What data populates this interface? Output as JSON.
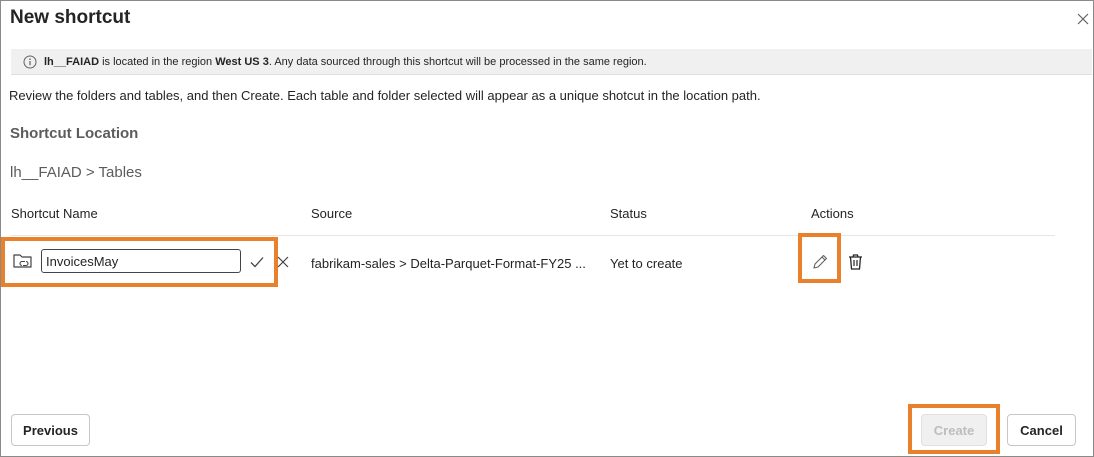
{
  "dialog": {
    "title": "New shortcut"
  },
  "banner": {
    "lakehouse": "lh__FAIAD",
    "text_1": "is located in the region",
    "region": "West US 3",
    "text_2": ". Any data sourced through this shortcut will be processed in the same region."
  },
  "description": "Review the folders and tables, and then Create. Each table and folder selected will appear as a unique shotcut in the location path.",
  "location": {
    "heading": "Shortcut Location",
    "path": "lh__FAIAD > Tables"
  },
  "table": {
    "headers": {
      "name": "Shortcut Name",
      "source": "Source",
      "status": "Status",
      "actions": "Actions"
    },
    "rows": [
      {
        "name": "InvoicesMay",
        "source": "fabrikam-sales > Delta-Parquet-Format-FY25 ...",
        "status": "Yet to create"
      }
    ]
  },
  "footer": {
    "previous": "Previous",
    "create": "Create",
    "cancel": "Cancel"
  },
  "colors": {
    "highlight": "#e8802c",
    "banner_bg": "#f0f0f0",
    "disabled_text": "#bdbdbd"
  }
}
